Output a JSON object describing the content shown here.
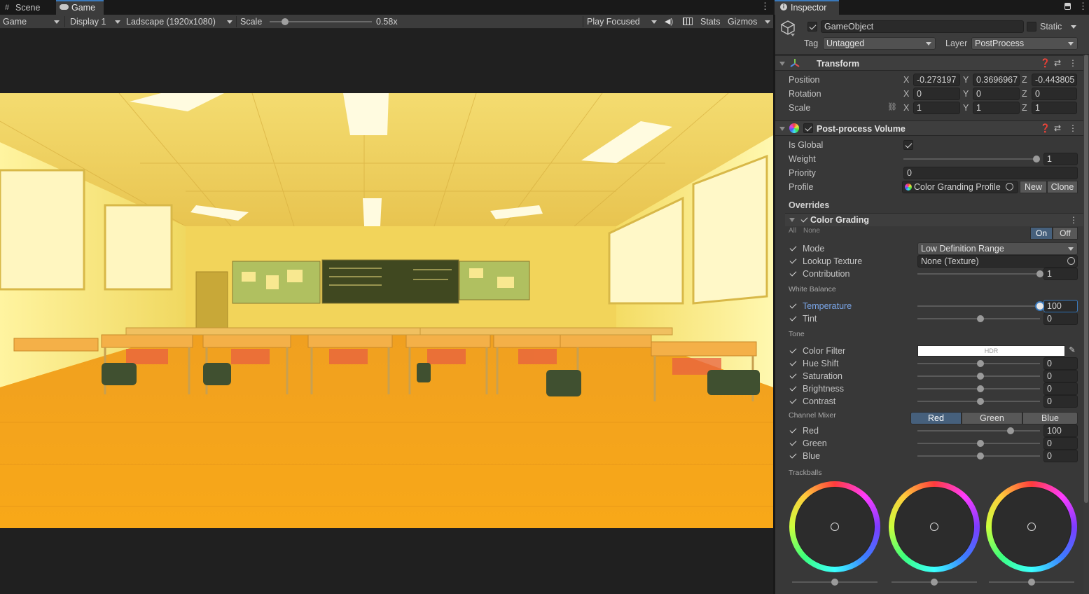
{
  "tabs_left": {
    "scene": "Scene",
    "game": "Game"
  },
  "tabs_right": {
    "inspector": "Inspector"
  },
  "game_toolbar": {
    "mode": "Game",
    "display": "Display 1",
    "resolution": "Ladscape (1920x1080)",
    "scale_label": "Scale",
    "scale_value": "0.58x",
    "scale_fraction": 0.15,
    "play_mode": "Play Focused",
    "stats": "Stats",
    "gizmos": "Gizmos"
  },
  "inspector": {
    "object_name": "GameObject",
    "static_label": "Static",
    "tag_label": "Tag",
    "tag_value": "Untagged",
    "layer_label": "Layer",
    "layer_value": "PostProcess",
    "transform": {
      "title": "Transform",
      "position_label": "Position",
      "rotation_label": "Rotation",
      "scale_label": "Scale",
      "axes": [
        "X",
        "Y",
        "Z"
      ],
      "position": [
        "-0.273197",
        "0.3696967",
        "-0.443805"
      ],
      "rotation": [
        "0",
        "0",
        "0"
      ],
      "scale": [
        "1",
        "1",
        "1"
      ]
    },
    "ppv": {
      "title": "Post-process Volume",
      "is_global_label": "Is Global",
      "weight_label": "Weight",
      "weight_value": "1",
      "weight_fraction": 1.0,
      "priority_label": "Priority",
      "priority_value": "0",
      "profile_label": "Profile",
      "profile_value": "Color Granding Profile",
      "new_label": "New",
      "clone_label": "Clone",
      "overrides_label": "Overrides"
    },
    "color_grading": {
      "title": "Color Grading",
      "all": "All",
      "none": "None",
      "on": "On",
      "off": "Off",
      "mode_label": "Mode",
      "mode_value": "Low Definition Range",
      "lut_label": "Lookup Texture",
      "lut_value": "None (Texture)",
      "contribution_label": "Contribution",
      "contribution_value": "1",
      "contribution_fraction": 1.0,
      "white_balance": "White Balance",
      "temperature_label": "Temperature",
      "temperature_value": "100",
      "temperature_fraction": 1.0,
      "tint_label": "Tint",
      "tint_value": "0",
      "tint_fraction": 0.5,
      "tone": "Tone",
      "color_filter_label": "Color Filter",
      "color_filter_text": "HDR",
      "hue_label": "Hue Shift",
      "hue_value": "0",
      "hue_fraction": 0.5,
      "saturation_label": "Saturation",
      "saturation_value": "0",
      "saturation_fraction": 0.5,
      "brightness_label": "Brightness",
      "brightness_value": "0",
      "brightness_fraction": 0.5,
      "contrast_label": "Contrast",
      "contrast_value": "0",
      "contrast_fraction": 0.5,
      "channel_mixer": "Channel Mixer",
      "ch_red_tab": "Red",
      "ch_green_tab": "Green",
      "ch_blue_tab": "Blue",
      "red_label": "Red",
      "red_value": "100",
      "red_fraction": 0.75,
      "green_label": "Green",
      "green_value": "0",
      "green_fraction": 0.5,
      "blue_label": "Blue",
      "blue_value": "0",
      "blue_fraction": 0.5,
      "trackballs": "Trackballs"
    }
  },
  "colors": {
    "accent": "#3a79bb",
    "temperature_label": "#7aa6e8",
    "on_button": "#46607c"
  }
}
